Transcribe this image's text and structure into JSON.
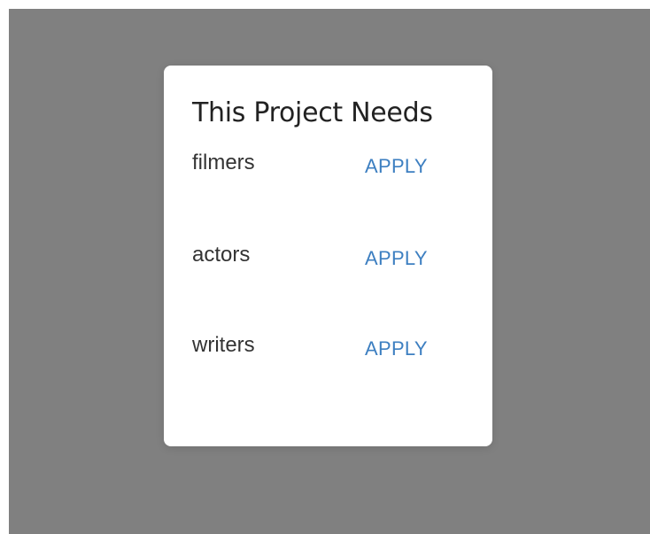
{
  "card": {
    "title": "This Project Needs",
    "needs": [
      {
        "role": "filmers",
        "action_label": "APPLY"
      },
      {
        "role": "actors",
        "action_label": "APPLY"
      },
      {
        "role": "writers",
        "action_label": "APPLY"
      }
    ]
  },
  "colors": {
    "backdrop": "#808080",
    "card_background": "#ffffff",
    "title_text": "#222222",
    "role_text": "#333333",
    "link_accent": "#3d7fc1"
  }
}
